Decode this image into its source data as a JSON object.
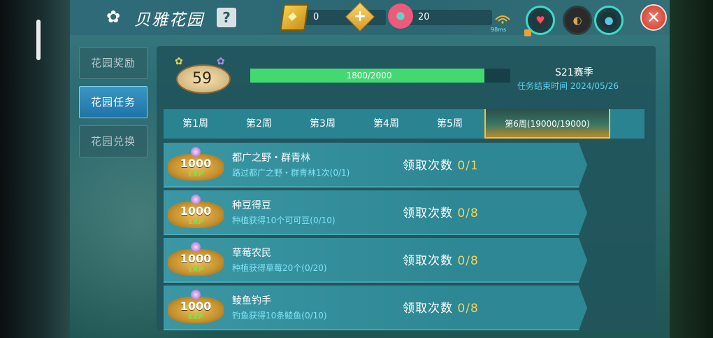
{
  "header": {
    "title": "贝雅花园",
    "help_label": "?",
    "gold_amount": "0",
    "plus_label": "+",
    "flower_amount": "20",
    "ping": "98ms",
    "close_label": "✕"
  },
  "sidebar": {
    "items": [
      {
        "label": "花园奖励",
        "active": false
      },
      {
        "label": "花园任务",
        "active": true
      },
      {
        "label": "花园兑换",
        "active": false
      }
    ]
  },
  "level": {
    "value": "59",
    "progress_text": "1800/2000",
    "progress_fraction": 0.9
  },
  "season": {
    "name": "S21赛季",
    "end_text": "任务结束时间 2024/05/26"
  },
  "tabs": [
    {
      "label": "第1周"
    },
    {
      "label": "第2周"
    },
    {
      "label": "第3周"
    },
    {
      "label": "第4周"
    },
    {
      "label": "第5周"
    },
    {
      "label": "第6周(19000/19000)",
      "active": true
    }
  ],
  "tasks": [
    {
      "reward": "1000",
      "reward_unit": "EXP",
      "name": "都广之野・群青林",
      "desc": "路过都广之野・群青林1次(0/1)",
      "claim_label": "领取次数",
      "claim_count": "0/1"
    },
    {
      "reward": "1000",
      "reward_unit": "EXP",
      "name": "种豆得豆",
      "desc": "种植获得10个可可豆(0/10)",
      "claim_label": "领取次数",
      "claim_count": "0/8"
    },
    {
      "reward": "1000",
      "reward_unit": "EXP",
      "name": "草莓农民",
      "desc": "种植获得草莓20个(0/20)",
      "claim_label": "领取次数",
      "claim_count": "0/8"
    },
    {
      "reward": "1000",
      "reward_unit": "EXP",
      "name": "鲮鱼钓手",
      "desc": "钓鱼获得10条鲮鱼(0/10)",
      "claim_label": "领取次数",
      "claim_count": "0/8"
    }
  ],
  "colors": {
    "progress": "#43d970",
    "accent_cyan": "#5fd3ef",
    "active_tab_border": "#f0c23c",
    "claim_count": "#f2d35b"
  }
}
